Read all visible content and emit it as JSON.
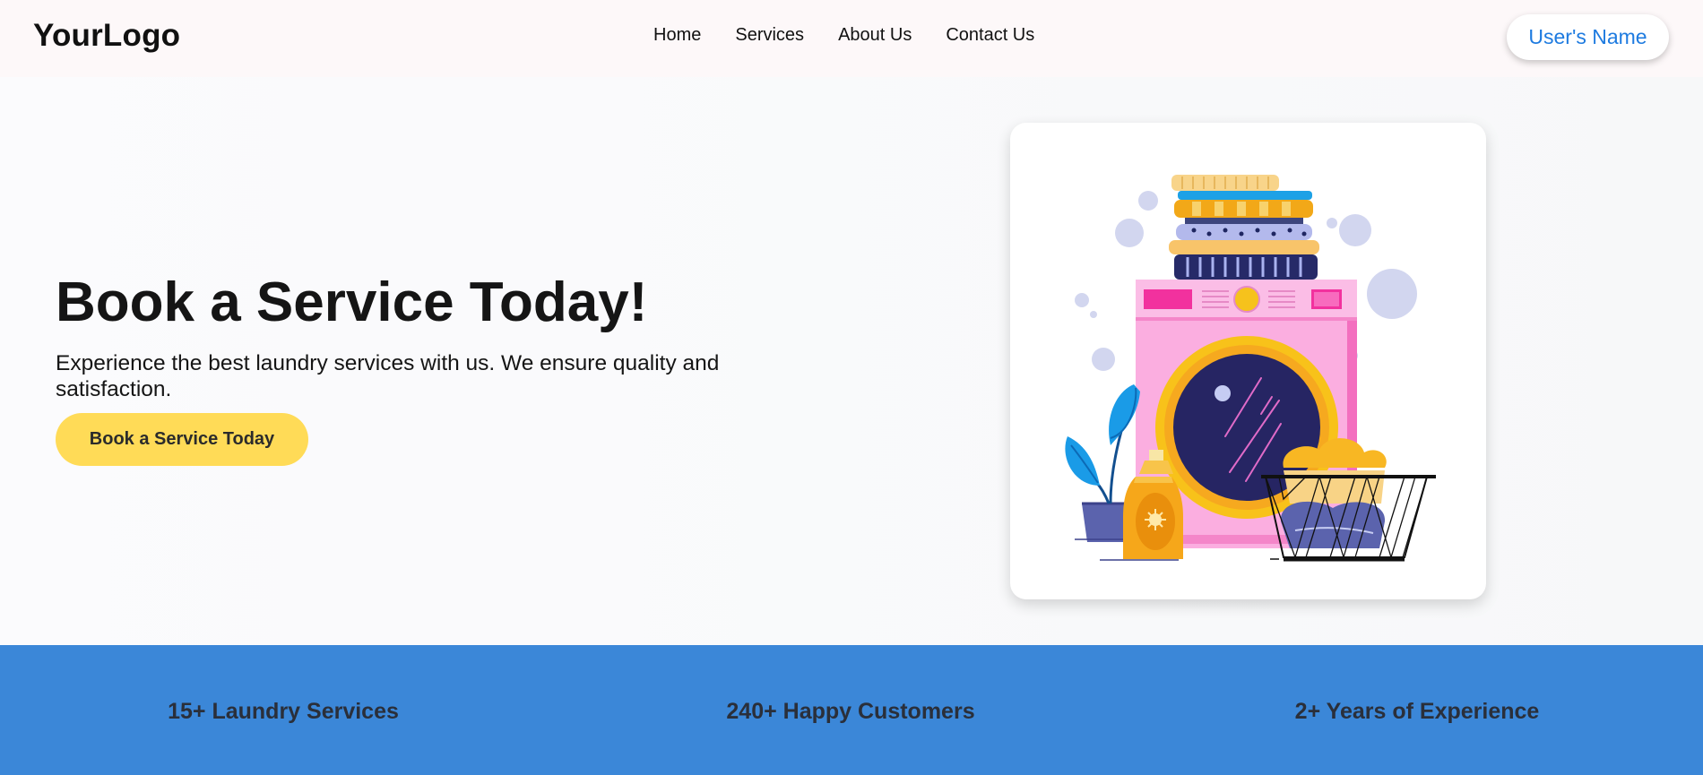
{
  "brand": {
    "logo_text": "YourLogo"
  },
  "nav": {
    "links": [
      "Home",
      "Services",
      "About Us",
      "Contact Us"
    ]
  },
  "user": {
    "name": "User's Name"
  },
  "hero": {
    "title": "Book a Service Today!",
    "subtitle": "Experience the best laundry services with us. We ensure quality and satisfaction.",
    "cta_label": "Book a Service Today"
  },
  "stats": [
    "15+ Laundry Services",
    "240+ Happy Customers",
    "2+ Years of Experience"
  ],
  "colors": {
    "accent_blue": "#3b87d8",
    "cta_yellow": "#ffdb57",
    "link_blue": "#1e7be0"
  },
  "illustration": {
    "icon": "washing-machine-laundry-illustration"
  }
}
